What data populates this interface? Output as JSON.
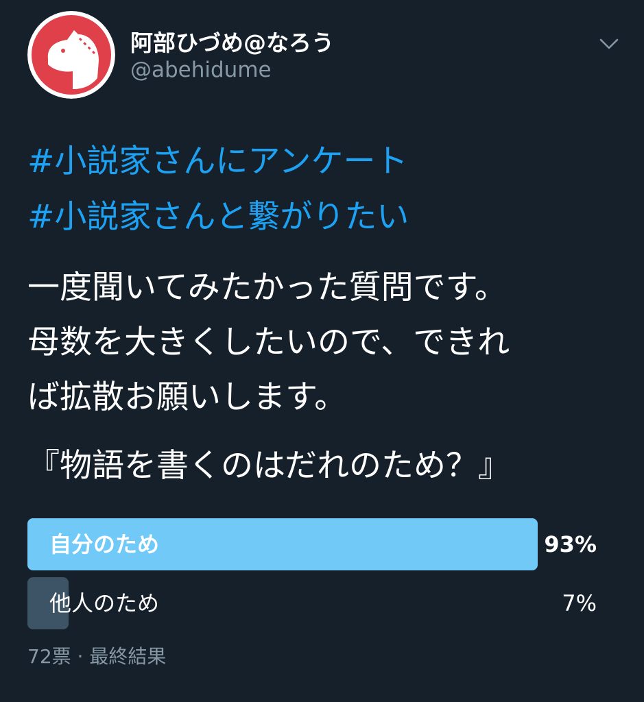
{
  "user": {
    "display_name": "阿部ひづめ@なろう",
    "handle": "@abehidume",
    "avatar_icon": "horse-head-logo",
    "avatar_bg": "#e0404a"
  },
  "header": {
    "menu_icon": "chevron-down-icon"
  },
  "tweet": {
    "hashtags": [
      "#小説家さんにアンケート",
      "#小説家さんと繋がりたい"
    ],
    "lines": [
      "一度聞いてみたかった質問です。",
      "母数を大きくしたいので、できれ",
      "ば拡散お願いします。"
    ],
    "question": "『物語を書くのはだれのため？』"
  },
  "poll": {
    "options": [
      {
        "label": "自分のため",
        "percent_text": "93%",
        "percent": 93,
        "winner": true
      },
      {
        "label": "他人のため",
        "percent_text": "7%",
        "percent": 7,
        "winner": false
      }
    ],
    "votes": "72票",
    "separator": "·",
    "status": "最終結果"
  },
  "colors": {
    "background": "#15202b",
    "hashtag": "#1da1f2",
    "winner_bar": "#71c9f8",
    "other_bar": "#3d5466",
    "muted_text": "#8899a6"
  }
}
